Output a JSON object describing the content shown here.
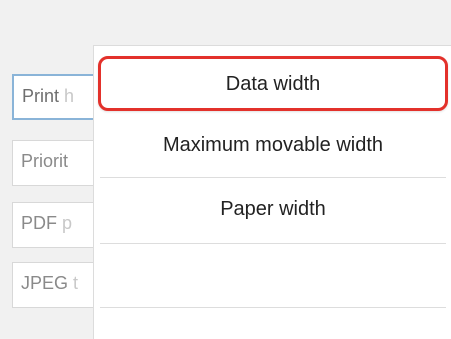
{
  "background_list": {
    "items": [
      {
        "visible_text": "Print",
        "faded_text": "h"
      },
      {
        "visible_text": "Priorit",
        "faded_text": ""
      },
      {
        "visible_text": "PDF",
        "faded_text": "p"
      },
      {
        "visible_text": "JPEG",
        "faded_text": "t"
      }
    ]
  },
  "popup": {
    "options": [
      {
        "label": "Data width",
        "selected": true
      },
      {
        "label": "Maximum movable width",
        "selected": false
      },
      {
        "label": "Paper width",
        "selected": false
      },
      {
        "label": "",
        "selected": false
      }
    ]
  },
  "colors": {
    "selection_border": "#e3312b",
    "background": "#f2f2f2",
    "popup_background": "#ffffff"
  }
}
